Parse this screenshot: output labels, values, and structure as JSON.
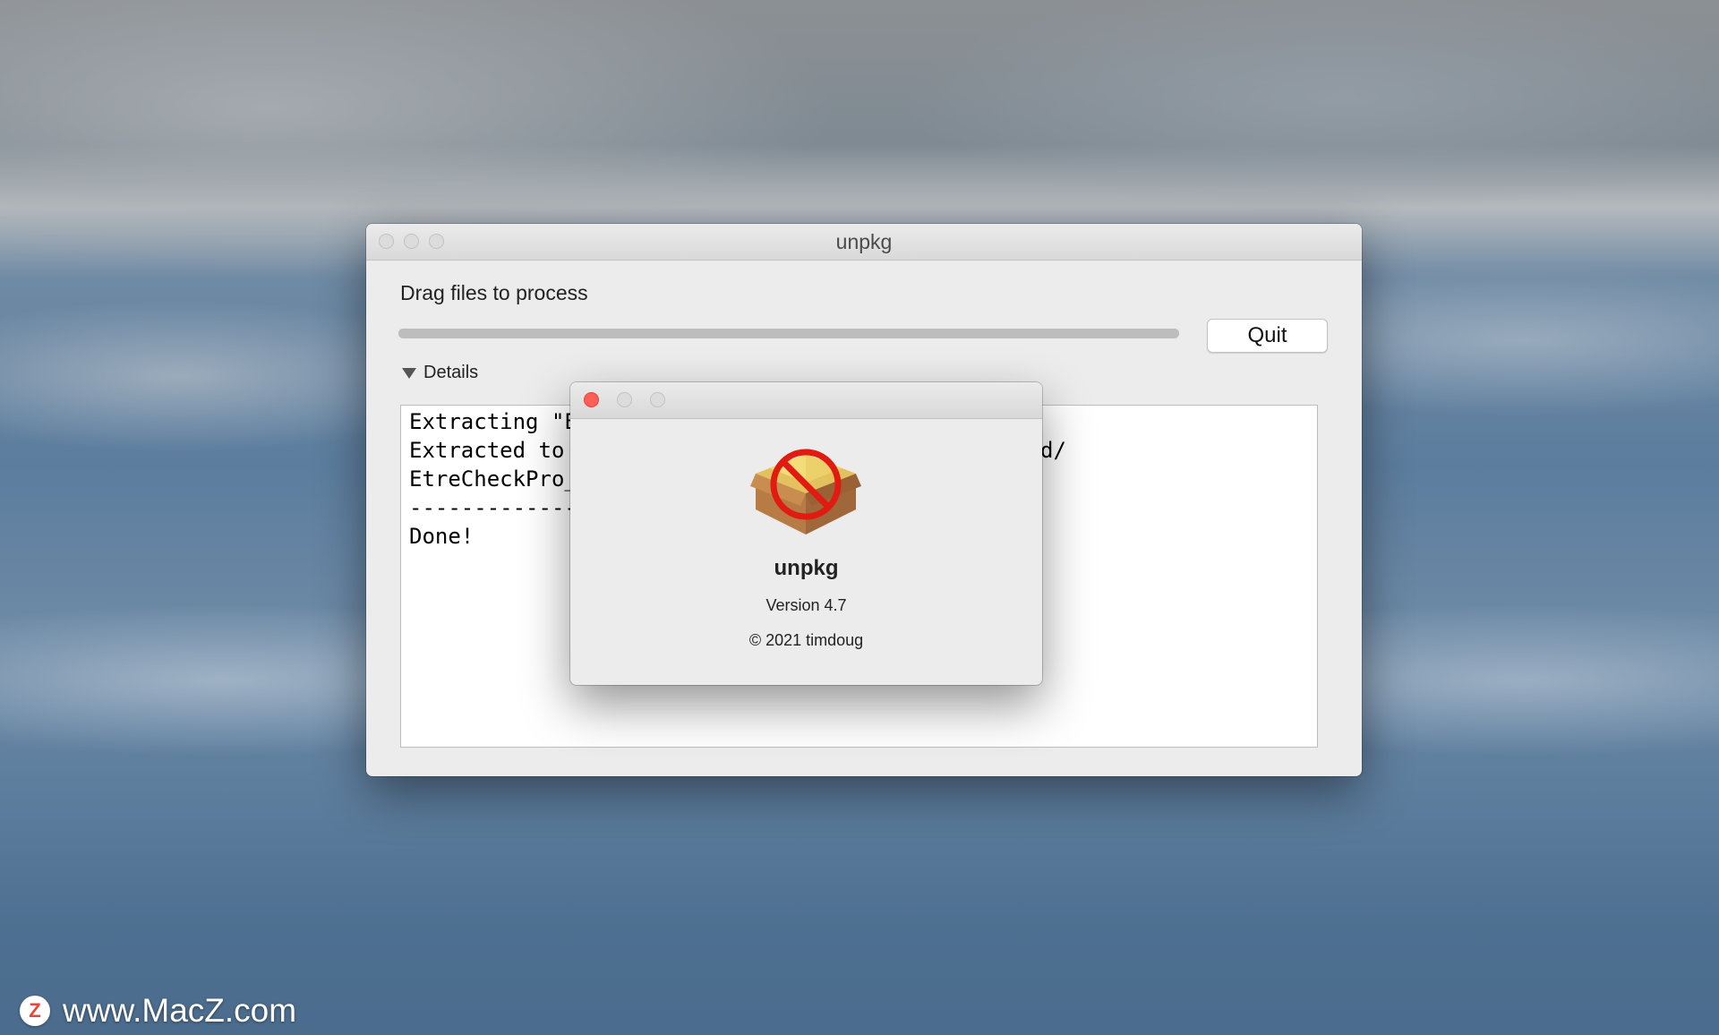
{
  "main_window": {
    "title": "unpkg",
    "drag_label": "Drag files to process",
    "progress_fraction": 1.0,
    "quit_label": "Quit",
    "details_label": "Details",
    "console_lines": [
      "Extracting \"E",
      "Extracted to",
      "EtreCheckPro_",
      "-------------",
      "Done!"
    ],
    "console_tail": "d/"
  },
  "about_window": {
    "app_name": "unpkg",
    "version": "Version 4.7",
    "copyright": "© 2021 timdoug",
    "icon": "package-forbidden-icon"
  },
  "colors": {
    "close_red": "#ff5f57",
    "window_bg": "#ececec",
    "forbidden_red": "#e01b12"
  },
  "watermark": {
    "logo_letter": "Z",
    "text": "www.MacZ.com"
  }
}
